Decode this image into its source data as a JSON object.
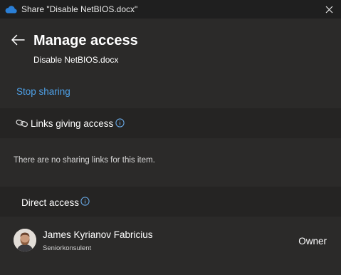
{
  "window": {
    "title": "Share \"Disable NetBIOS.docx\"",
    "app_icon": "onedrive-cloud-icon",
    "close_icon": "close-icon"
  },
  "header": {
    "back_icon": "back-arrow-icon",
    "title": "Manage access",
    "filename": "Disable NetBIOS.docx"
  },
  "actions": {
    "stop_sharing": "Stop sharing"
  },
  "links_section": {
    "icon": "link-icon",
    "label": "Links giving access",
    "info_icon": "info-icon",
    "empty_text": "There are no sharing links for this item."
  },
  "direct_section": {
    "label": "Direct access",
    "info_icon": "info-icon",
    "people": [
      {
        "name": "James Kyrianov Fabricius",
        "title": "Seniorkonsulent",
        "role": "Owner"
      }
    ]
  },
  "colors": {
    "background": "#2b2a29",
    "band": "#252423",
    "titlebar": "#1f1f1f",
    "accent_link": "#4ea1e8",
    "info_icon": "#6cb0f0",
    "onedrive_blue": "#2a7fd6"
  }
}
